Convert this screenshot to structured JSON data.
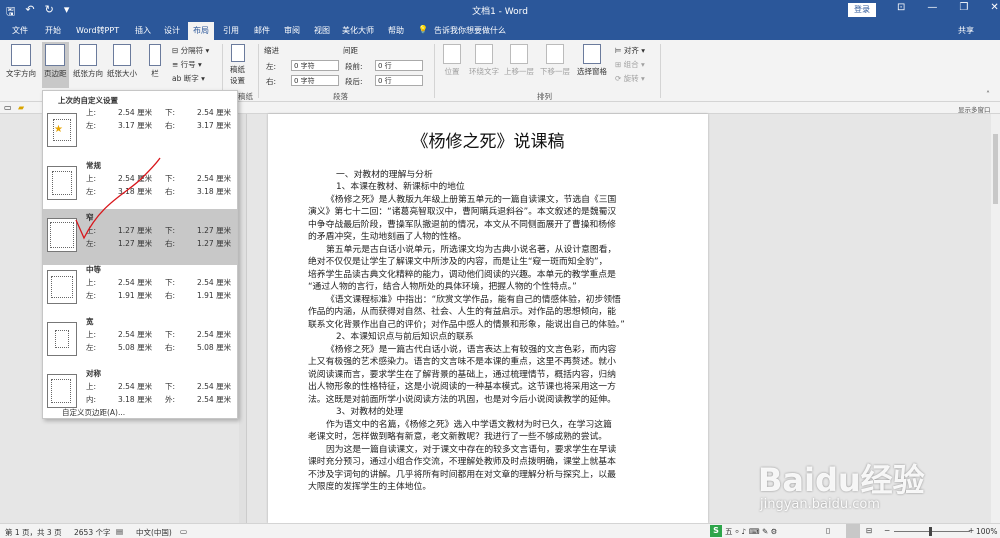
{
  "titlebar": {
    "title": "文档1 - Word",
    "login": "登录",
    "qa_icons": [
      "save-icon",
      "undo-icon",
      "redo-icon",
      "customize-icon"
    ]
  },
  "tabs": [
    {
      "label": "文件"
    },
    {
      "label": "开始"
    },
    {
      "label": "Word转PPT"
    },
    {
      "label": "插入"
    },
    {
      "label": "设计"
    },
    {
      "label": "布局"
    },
    {
      "label": "引用"
    },
    {
      "label": "邮件"
    },
    {
      "label": "审阅"
    },
    {
      "label": "视图"
    },
    {
      "label": "美化大师"
    },
    {
      "label": "帮助"
    },
    {
      "label": "告诉我你想要做什么"
    },
    {
      "label": "共享"
    }
  ],
  "ribbon": {
    "text_direction": "文字方向",
    "margins": "页边距",
    "orientation": "纸张方向",
    "size": "纸张大小",
    "columns": "栏",
    "breaks": "分隔符",
    "line_numbers": "行号",
    "hyphenation": "断字",
    "paper_settings_1": "稿纸",
    "paper_settings_2": "设置",
    "indent": "缩进",
    "spacing": "间距",
    "left_label": "左:",
    "right_label": "右:",
    "before_label": "段前:",
    "after_label": "段后:",
    "left_val": "0 字符",
    "right_val": "0 字符",
    "before_val": "0 行",
    "after_val": "0 行",
    "paragraph_group": "段落",
    "arrange_group": "排列",
    "paper_group": "稿纸",
    "position": "位置",
    "wrap": "环绕文字",
    "forward": "上移一层",
    "backward": "下移一层",
    "selection_pane": "选择窗格",
    "align": "对齐",
    "group": "组合",
    "rotate": "旋转",
    "show_multipage": "显示多窗口"
  },
  "margins_menu": {
    "header": "上次的自定义设置",
    "options": [
      {
        "name": "",
        "l1a": "上:",
        "v1a": "2.54 厘米",
        "l1b": "下:",
        "v1b": "2.54 厘米",
        "l2a": "左:",
        "v2a": "3.17 厘米",
        "l2b": "右:",
        "v2b": "3.17 厘米"
      },
      {
        "name": "常规",
        "l1a": "上:",
        "v1a": "2.54 厘米",
        "l1b": "下:",
        "v1b": "2.54 厘米",
        "l2a": "左:",
        "v2a": "3.18 厘米",
        "l2b": "右:",
        "v2b": "3.18 厘米"
      },
      {
        "name": "窄",
        "l1a": "上:",
        "v1a": "1.27 厘米",
        "l1b": "下:",
        "v1b": "1.27 厘米",
        "l2a": "左:",
        "v2a": "1.27 厘米",
        "l2b": "右:",
        "v2b": "1.27 厘米"
      },
      {
        "name": "中等",
        "l1a": "上:",
        "v1a": "2.54 厘米",
        "l1b": "下:",
        "v1b": "2.54 厘米",
        "l2a": "左:",
        "v2a": "1.91 厘米",
        "l2b": "右:",
        "v2b": "1.91 厘米"
      },
      {
        "name": "宽",
        "l1a": "上:",
        "v1a": "2.54 厘米",
        "l1b": "下:",
        "v1b": "2.54 厘米",
        "l2a": "左:",
        "v2a": "5.08 厘米",
        "l2b": "右:",
        "v2b": "5.08 厘米"
      },
      {
        "name": "对称",
        "l1a": "上:",
        "v1a": "2.54 厘米",
        "l1b": "下:",
        "v1b": "2.54 厘米",
        "l2a": "内:",
        "v2a": "3.18 厘米",
        "l2b": "外:",
        "v2b": "2.54 厘米"
      }
    ],
    "custom": "自定义页边距(A)..."
  },
  "document": {
    "title": "《杨修之死》说课稿",
    "lines": [
      "",
      "一、对教材的理解与分析",
      "1、本课在教材、新课标中的地位",
      "《杨修之死》是人教版九年级上册第五单元的一篇自读课文，节选自《三国",
      "演义》第七十二回：“诸葛亮智取汉中，曹阿瞒兵退斜谷”。本文叙述的是魏蜀汉",
      "中争夺战最后阶段，曹操军队撤退前的情况，本文从不同侧面展开了曹操和杨修",
      "的矛盾冲突，生动地刻画了人物的性格。",
      "第五单元是古白话小说单元，所选课文均为古典小说名著，从设计意图看，",
      "绝对不仅仅是让学生了解课文中所涉及的内容，而是让生“窥一斑而知全豹”，",
      "培养学生品读古典文化精粹的能力，调动他们阅读的兴趣。本单元的教学重点是",
      "“通过人物的言行，结合人物所处的具体环境，把握人物的个性特点。”",
      "《语文课程标准》中指出：“欣赏文学作品，能有自己的情感体验，初步领悟",
      "作品的内涵，从而获得对自然、社会、人生的有益启示。对作品的思想倾向，能",
      "联系文化背景作出自己的评价；对作品中感人的情景和形象，能说出自己的体验。”",
      "2、本课知识点与前后知识点的联系",
      "《杨修之死》是一篇古代白话小说，语言表达上有较强的文言色彩，而内容",
      "上又有极强的艺术感染力。语言的文言味不是本课的重点，这里不再赘述。就小",
      "说阅读课而言，要求学生在了解背景的基础上，通过梳理情节，概括内容，归纳",
      "出人物形象的性格特征，这是小说阅读的一种基本模式。这节课也将采用这一方",
      "法。这既是对前面所学小说阅读方法的巩固，也是对今后小说阅读教学的延伸。",
      "3、对教材的处理",
      "作为语文中的名篇，《杨修之死》选入中学语文教材为时已久，在学习这篇",
      "老课文时，怎样做到略有新意，老文新教呢？我进行了一些不够成熟的尝试。",
      "因为这是一篇自读课文，对于课文中存在的较多文言语句，要求学生在早读",
      "课时充分预习，通过小组合作交流，不理解处教师及时点拨明确，课堂上就基本",
      "不涉及字词句的讲解。几乎将所有时间都用在对文章的理解分析与探究上，以最",
      "大限度的发挥学生的主体地位。"
    ]
  },
  "status": {
    "page": "第 1 页，共 3 页",
    "words": "2653 个字",
    "lang": "中文(中国)",
    "zoom": "100%"
  },
  "watermark": {
    "big": "Baidu经验",
    "small": "jingyan.baidu.com"
  }
}
